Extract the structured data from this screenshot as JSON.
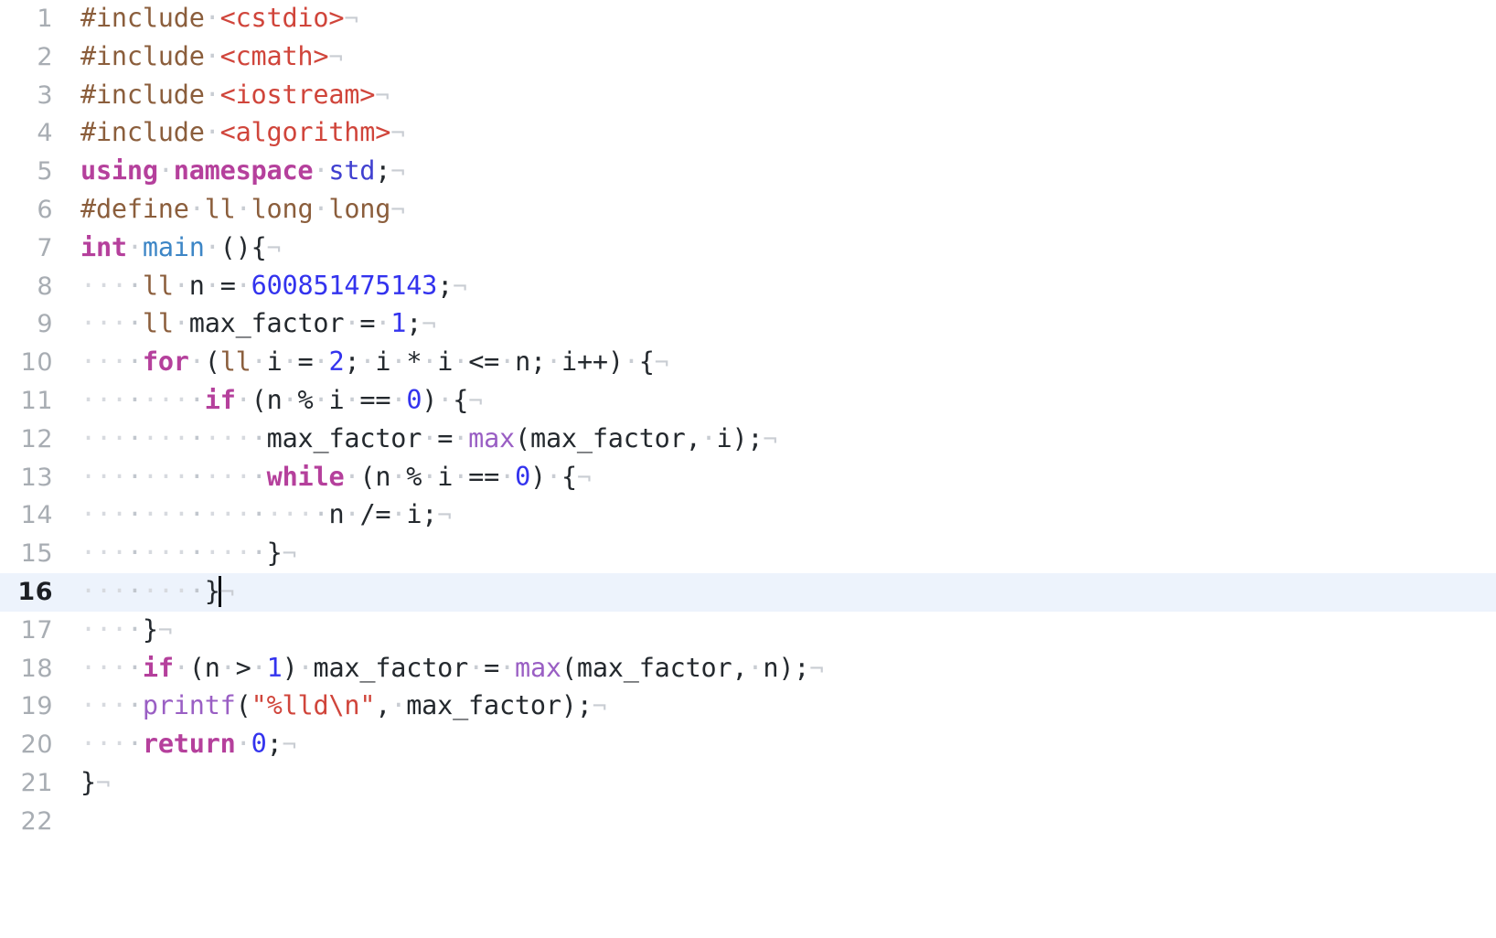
{
  "editor": {
    "language": "cpp",
    "render_whitespace": true,
    "active_line": 16,
    "total_lines": 22,
    "caret_line": 16,
    "caret_column": 9,
    "colors": {
      "background": "#ffffff",
      "active_line_background": "#edf3fc",
      "gutter_text": "#a8adb3",
      "gutter_text_active": "#1c1f23",
      "default_text": "#24292e",
      "keyword": "#b5409c",
      "macro": "#8b5e3c",
      "type": "#8b5e3c",
      "string": "#d0453b",
      "number": "#3333ee",
      "function_call": "#9a5fc4",
      "function_def": "#3d86c6",
      "namespace": "#4040d0",
      "whitespace_dot": "#d7dadf",
      "eol_marker": "#c9cdd3"
    },
    "whitespace_glyphs": {
      "space": "·",
      "eol": "¬"
    },
    "lines": [
      {
        "n": "1",
        "indent": 0,
        "text": "#include <cstdio>",
        "eol": true
      },
      {
        "n": "2",
        "indent": 0,
        "text": "#include <cmath>",
        "eol": true
      },
      {
        "n": "3",
        "indent": 0,
        "text": "#include <iostream>",
        "eol": true
      },
      {
        "n": "4",
        "indent": 0,
        "text": "#include <algorithm>",
        "eol": true
      },
      {
        "n": "5",
        "indent": 0,
        "text": "using namespace std;",
        "eol": true
      },
      {
        "n": "6",
        "indent": 0,
        "text": "#define ll long long",
        "eol": true
      },
      {
        "n": "7",
        "indent": 0,
        "text": "int main (){",
        "eol": true
      },
      {
        "n": "8",
        "indent": 4,
        "text": "ll n = 600851475143;",
        "eol": true
      },
      {
        "n": "9",
        "indent": 4,
        "text": "ll max_factor = 1;",
        "eol": true
      },
      {
        "n": "10",
        "indent": 4,
        "text": "for (ll i = 2; i * i <= n; i++) {",
        "eol": true
      },
      {
        "n": "11",
        "indent": 8,
        "text": "if (n % i == 0) {",
        "eol": true
      },
      {
        "n": "12",
        "indent": 12,
        "text": "max_factor = max(max_factor, i);",
        "eol": true
      },
      {
        "n": "13",
        "indent": 12,
        "text": "while (n % i == 0) {",
        "eol": true
      },
      {
        "n": "14",
        "indent": 16,
        "text": "n /= i;",
        "eol": true
      },
      {
        "n": "15",
        "indent": 12,
        "text": "}",
        "eol": true
      },
      {
        "n": "16",
        "indent": 8,
        "text": "}",
        "eol": true
      },
      {
        "n": "17",
        "indent": 4,
        "text": "}",
        "eol": true
      },
      {
        "n": "18",
        "indent": 4,
        "text": "if (n > 1) max_factor = max(max_factor, n);",
        "eol": true
      },
      {
        "n": "19",
        "indent": 4,
        "text": "printf(\"%lld\\n\", max_factor);",
        "eol": true
      },
      {
        "n": "20",
        "indent": 4,
        "text": "return 0;",
        "eol": true
      },
      {
        "n": "21",
        "indent": 0,
        "text": "}",
        "eol": true
      },
      {
        "n": "22",
        "indent": 0,
        "text": "",
        "eol": false
      }
    ],
    "tokens": [
      [
        {
          "t": "macro",
          "v": "#include"
        },
        {
          "t": "sp"
        },
        {
          "t": "str",
          "v": "<cstdio>"
        }
      ],
      [
        {
          "t": "macro",
          "v": "#include"
        },
        {
          "t": "sp"
        },
        {
          "t": "str",
          "v": "<cmath>"
        }
      ],
      [
        {
          "t": "macro",
          "v": "#include"
        },
        {
          "t": "sp"
        },
        {
          "t": "str",
          "v": "<iostream>"
        }
      ],
      [
        {
          "t": "macro",
          "v": "#include"
        },
        {
          "t": "sp"
        },
        {
          "t": "str",
          "v": "<algorithm>"
        }
      ],
      [
        {
          "t": "kw",
          "v": "using"
        },
        {
          "t": "sp"
        },
        {
          "t": "kw",
          "v": "namespace"
        },
        {
          "t": "sp"
        },
        {
          "t": "ns",
          "v": "std"
        },
        {
          "t": "punc",
          "v": ";"
        }
      ],
      [
        {
          "t": "macro",
          "v": "#define"
        },
        {
          "t": "sp"
        },
        {
          "t": "type",
          "v": "ll"
        },
        {
          "t": "sp"
        },
        {
          "t": "type",
          "v": "long"
        },
        {
          "t": "sp"
        },
        {
          "t": "type",
          "v": "long"
        }
      ],
      [
        {
          "t": "kw",
          "v": "int"
        },
        {
          "t": "sp"
        },
        {
          "t": "fndef",
          "v": "main"
        },
        {
          "t": "sp"
        },
        {
          "t": "punc",
          "v": "(){"
        }
      ],
      [
        {
          "t": "type",
          "v": "ll"
        },
        {
          "t": "sp"
        },
        {
          "t": "plain",
          "v": "n"
        },
        {
          "t": "sp"
        },
        {
          "t": "plain",
          "v": "="
        },
        {
          "t": "sp"
        },
        {
          "t": "num",
          "v": "600851475143"
        },
        {
          "t": "punc",
          "v": ";"
        }
      ],
      [
        {
          "t": "type",
          "v": "ll"
        },
        {
          "t": "sp"
        },
        {
          "t": "plain",
          "v": "max_factor"
        },
        {
          "t": "sp"
        },
        {
          "t": "plain",
          "v": "="
        },
        {
          "t": "sp"
        },
        {
          "t": "num",
          "v": "1"
        },
        {
          "t": "punc",
          "v": ";"
        }
      ],
      [
        {
          "t": "ctrl",
          "v": "for"
        },
        {
          "t": "sp"
        },
        {
          "t": "punc",
          "v": "("
        },
        {
          "t": "type",
          "v": "ll"
        },
        {
          "t": "sp"
        },
        {
          "t": "plain",
          "v": "i"
        },
        {
          "t": "sp"
        },
        {
          "t": "plain",
          "v": "="
        },
        {
          "t": "sp"
        },
        {
          "t": "num",
          "v": "2"
        },
        {
          "t": "punc",
          "v": ";"
        },
        {
          "t": "sp"
        },
        {
          "t": "plain",
          "v": "i"
        },
        {
          "t": "sp"
        },
        {
          "t": "plain",
          "v": "*"
        },
        {
          "t": "sp"
        },
        {
          "t": "plain",
          "v": "i"
        },
        {
          "t": "sp"
        },
        {
          "t": "plain",
          "v": "<="
        },
        {
          "t": "sp"
        },
        {
          "t": "plain",
          "v": "n"
        },
        {
          "t": "punc",
          "v": ";"
        },
        {
          "t": "sp"
        },
        {
          "t": "plain",
          "v": "i++)"
        },
        {
          "t": "sp"
        },
        {
          "t": "punc",
          "v": "{"
        }
      ],
      [
        {
          "t": "ctrl",
          "v": "if"
        },
        {
          "t": "sp"
        },
        {
          "t": "punc",
          "v": "("
        },
        {
          "t": "plain",
          "v": "n"
        },
        {
          "t": "sp"
        },
        {
          "t": "plain",
          "v": "%"
        },
        {
          "t": "sp"
        },
        {
          "t": "plain",
          "v": "i"
        },
        {
          "t": "sp"
        },
        {
          "t": "plain",
          "v": "=="
        },
        {
          "t": "sp"
        },
        {
          "t": "num",
          "v": "0"
        },
        {
          "t": "punc",
          "v": ")"
        },
        {
          "t": "sp"
        },
        {
          "t": "punc",
          "v": "{"
        }
      ],
      [
        {
          "t": "plain",
          "v": "max_factor"
        },
        {
          "t": "sp"
        },
        {
          "t": "plain",
          "v": "="
        },
        {
          "t": "sp"
        },
        {
          "t": "fn",
          "v": "max"
        },
        {
          "t": "punc",
          "v": "("
        },
        {
          "t": "plain",
          "v": "max_factor,"
        },
        {
          "t": "sp"
        },
        {
          "t": "plain",
          "v": "i);"
        }
      ],
      [
        {
          "t": "ctrl",
          "v": "while"
        },
        {
          "t": "sp"
        },
        {
          "t": "punc",
          "v": "("
        },
        {
          "t": "plain",
          "v": "n"
        },
        {
          "t": "sp"
        },
        {
          "t": "plain",
          "v": "%"
        },
        {
          "t": "sp"
        },
        {
          "t": "plain",
          "v": "i"
        },
        {
          "t": "sp"
        },
        {
          "t": "plain",
          "v": "=="
        },
        {
          "t": "sp"
        },
        {
          "t": "num",
          "v": "0"
        },
        {
          "t": "punc",
          "v": ")"
        },
        {
          "t": "sp"
        },
        {
          "t": "punc",
          "v": "{"
        }
      ],
      [
        {
          "t": "plain",
          "v": "n"
        },
        {
          "t": "sp"
        },
        {
          "t": "plain",
          "v": "/="
        },
        {
          "t": "sp"
        },
        {
          "t": "plain",
          "v": "i;"
        }
      ],
      [
        {
          "t": "punc",
          "v": "}"
        }
      ],
      [
        {
          "t": "punc",
          "v": "}"
        },
        {
          "t": "caret"
        }
      ],
      [
        {
          "t": "punc",
          "v": "}"
        }
      ],
      [
        {
          "t": "ctrl",
          "v": "if"
        },
        {
          "t": "sp"
        },
        {
          "t": "punc",
          "v": "("
        },
        {
          "t": "plain",
          "v": "n"
        },
        {
          "t": "sp"
        },
        {
          "t": "plain",
          "v": ">"
        },
        {
          "t": "sp"
        },
        {
          "t": "num",
          "v": "1"
        },
        {
          "t": "punc",
          "v": ")"
        },
        {
          "t": "sp"
        },
        {
          "t": "plain",
          "v": "max_factor"
        },
        {
          "t": "sp"
        },
        {
          "t": "plain",
          "v": "="
        },
        {
          "t": "sp"
        },
        {
          "t": "fn",
          "v": "max"
        },
        {
          "t": "punc",
          "v": "("
        },
        {
          "t": "plain",
          "v": "max_factor,"
        },
        {
          "t": "sp"
        },
        {
          "t": "plain",
          "v": "n);"
        }
      ],
      [
        {
          "t": "fn",
          "v": "printf"
        },
        {
          "t": "punc",
          "v": "("
        },
        {
          "t": "str",
          "v": "\"%lld\\n\""
        },
        {
          "t": "punc",
          "v": ","
        },
        {
          "t": "sp"
        },
        {
          "t": "plain",
          "v": "max_factor);"
        }
      ],
      [
        {
          "t": "ctrl",
          "v": "return"
        },
        {
          "t": "sp"
        },
        {
          "t": "num",
          "v": "0"
        },
        {
          "t": "punc",
          "v": ";"
        }
      ],
      [
        {
          "t": "punc",
          "v": "}"
        }
      ],
      []
    ]
  }
}
